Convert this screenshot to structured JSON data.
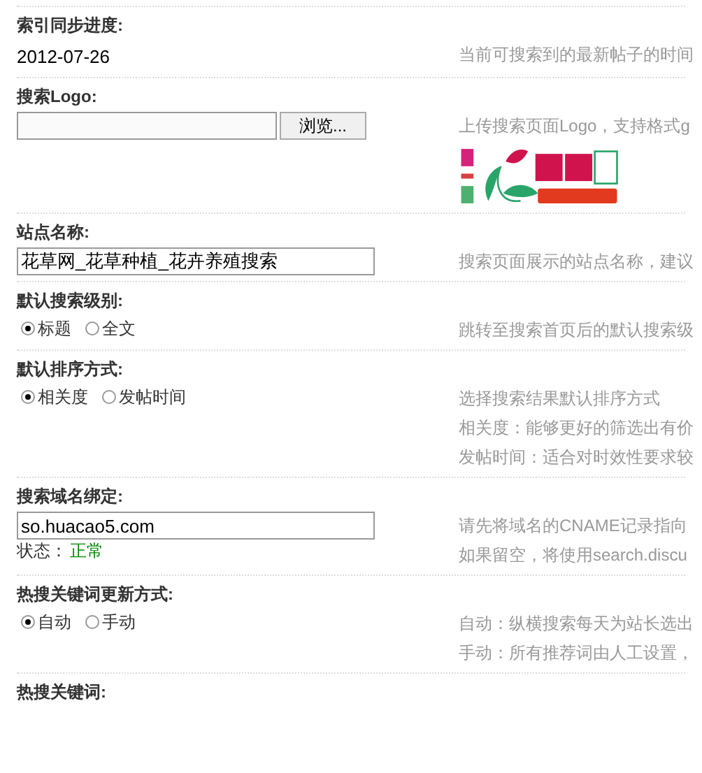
{
  "sections": [
    {
      "kind": "text",
      "label": "索引同步进度:",
      "value": "2012-07-26",
      "hints": [
        "当前可搜索到的最新帖子的时间"
      ]
    },
    {
      "kind": "file",
      "label": "搜索Logo:",
      "button": "浏览...",
      "hints": [
        "上传搜索页面Logo，支持格式g"
      ],
      "logo": {
        "kind": "picture"
      }
    },
    {
      "kind": "input",
      "label": "站点名称:",
      "value": "花草网_花草种植_花卉养殖搜索",
      "hints": [
        "搜索页面展示的站点名称，建议"
      ]
    },
    {
      "kind": "radio",
      "label": "默认搜索级别:",
      "options": [
        {
          "label": "标题",
          "selected": true
        },
        {
          "label": "全文",
          "selected": false
        }
      ],
      "hints": [
        "跳转至搜索首页后的默认搜索级"
      ]
    },
    {
      "kind": "radio",
      "label": "默认排序方式:",
      "options": [
        {
          "label": "相关度",
          "selected": true
        },
        {
          "label": "发帖时间",
          "selected": false
        }
      ],
      "hints": [
        "选择搜索结果默认排序方式",
        "相关度：能够更好的筛选出有价",
        "发帖时间：适合对时效性要求较"
      ]
    },
    {
      "kind": "input",
      "label": "搜索域名绑定:",
      "value": "so.huacao5.com",
      "status": {
        "label": "状态：",
        "value": "正常"
      },
      "hints": [
        "请先将域名的CNAME记录指向",
        "如果留空，将使用search.discu"
      ]
    },
    {
      "kind": "radio",
      "label": "热搜关键词更新方式:",
      "options": [
        {
          "label": "自动",
          "selected": true
        },
        {
          "label": "手动",
          "selected": false
        }
      ],
      "hints": [
        "自动：纵横搜索每天为站长选出",
        "手动：所有推荐词由人工设置，"
      ]
    },
    {
      "kind": "label_only",
      "label": "热搜关键词:"
    }
  ]
}
